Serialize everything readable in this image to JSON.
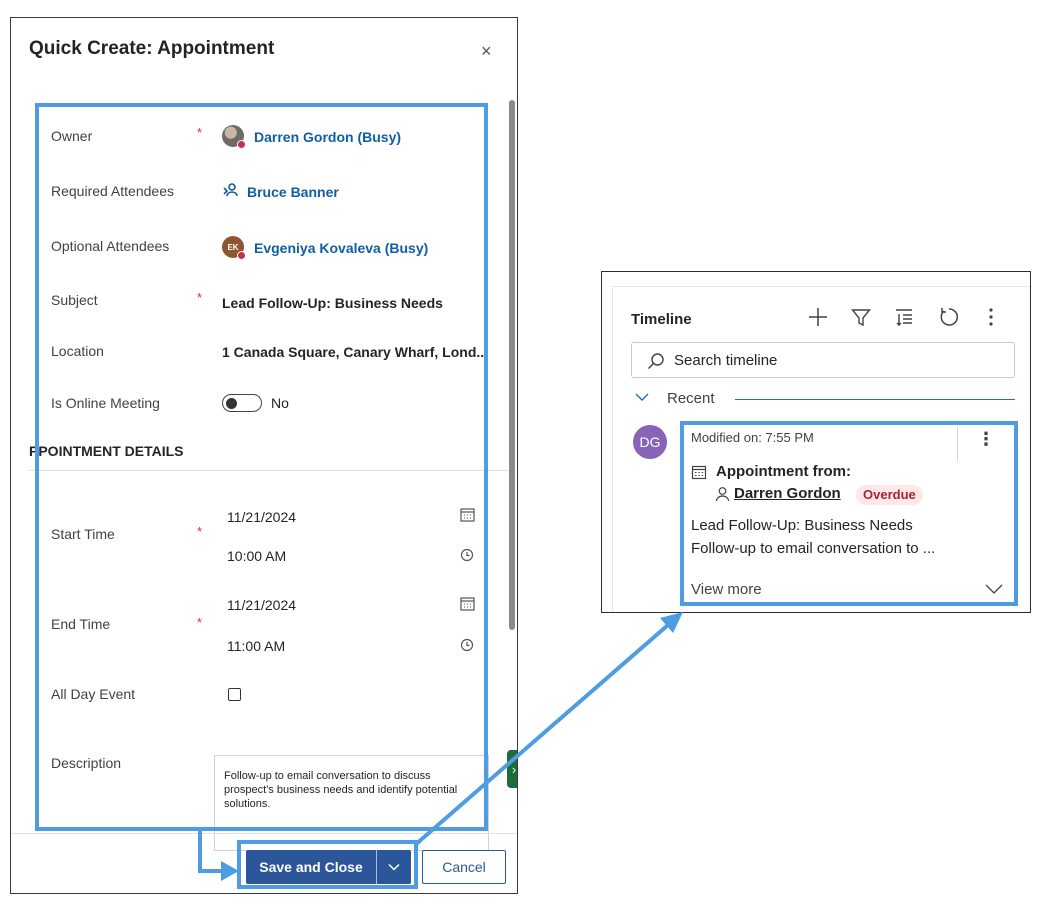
{
  "quick_create": {
    "title": "Quick Create: Appointment",
    "close_glyph": "×",
    "fields": {
      "owner": {
        "label": "Owner",
        "value": "Darren Gordon (Busy)"
      },
      "required_attendees": {
        "label": "Required Attendees",
        "value": "Bruce Banner"
      },
      "optional_attendees": {
        "label": "Optional Attendees",
        "value": "Evgeniya Kovaleva (Busy)",
        "avatar_initials": "EK"
      },
      "subject": {
        "label": "Subject",
        "value": "Lead Follow-Up: Business Needs"
      },
      "location": {
        "label": "Location",
        "value": "1 Canada Square, Canary Wharf, Lond..."
      },
      "is_online_meeting": {
        "label": "Is Online Meeting",
        "value": "No",
        "checked": false
      }
    },
    "section_title": "APPOINTMENT DETAILS",
    "section_title_visible": "PPOINTMENT DETAILS",
    "details": {
      "start_time": {
        "label": "Start Time",
        "date": "11/21/2024",
        "time": "10:00 AM"
      },
      "end_time": {
        "label": "End Time",
        "date": "11/21/2024",
        "time": "11:00 AM"
      },
      "all_day_event": {
        "label": "All Day Event",
        "checked": false
      },
      "description": {
        "label": "Description",
        "value": "Follow-up to email conversation to discuss prospect's business needs and identify potential solutions."
      }
    },
    "required_marker": "*",
    "footer": {
      "save_label": "Save and Close",
      "cancel_label": "Cancel"
    }
  },
  "timeline": {
    "title": "Timeline",
    "search_placeholder": "Search timeline",
    "group_label": "Recent",
    "record": {
      "avatar_initials": "DG",
      "modified": "Modified on: 7:55 PM",
      "heading": "Appointment from:",
      "person": "Darren Gordon",
      "badge": "Overdue",
      "line1": "Lead Follow-Up: Business Needs",
      "line2": "Follow-up to email conversation to ...",
      "view_more": "View more"
    },
    "toolbar_icons": [
      "plus-icon",
      "filter-icon",
      "sort-icon",
      "refresh-icon",
      "more-vertical-icon"
    ]
  },
  "colors": {
    "accent": "#2b579a",
    "link": "#115ea3",
    "highlight": "#4d9de0",
    "required": "#d13438",
    "overdue_bg": "#fde7e9",
    "overdue_text": "#a4262c",
    "dg_avatar": "#8764b8"
  }
}
